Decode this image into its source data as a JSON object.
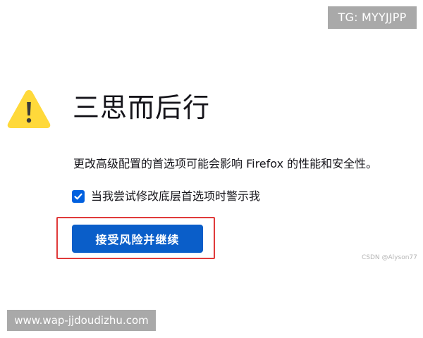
{
  "watermarks": {
    "tg_label": "TG: MYYJJPP",
    "csdn_label": "CSDN @Alyson77",
    "url_label": "www.wap-jjdoudizhu.com"
  },
  "warning": {
    "icon": "warning-triangle-icon",
    "icon_color": "#ffd93a",
    "title": "三思而后行",
    "description": "更改高级配置的首选项可能会影响 Firefox 的性能和安全性。"
  },
  "checkbox": {
    "checked": true,
    "label": "当我尝试修改底层首选项时警示我"
  },
  "accept_button": {
    "label": "接受风险并继续"
  },
  "colors": {
    "accent": "#0a5ec9",
    "highlight": "#e03a3a",
    "watermark_bg": "#a9a9a9"
  }
}
